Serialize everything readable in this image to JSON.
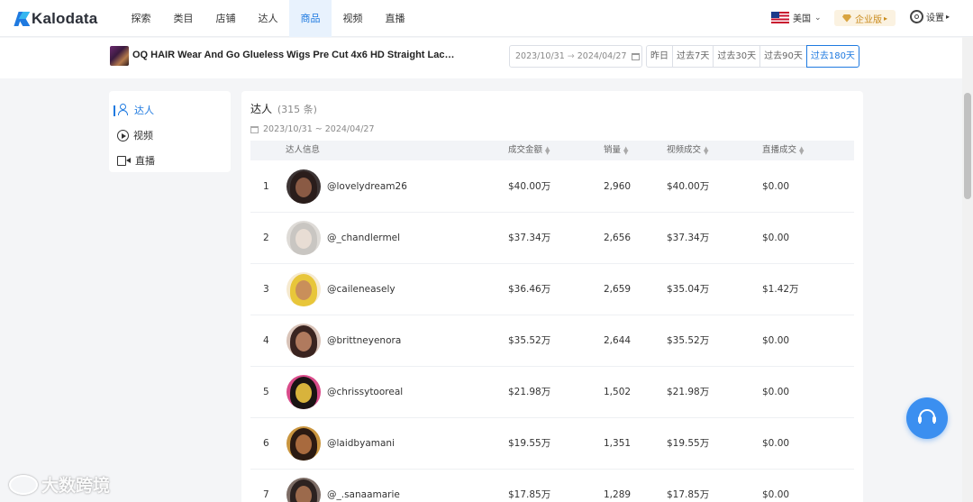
{
  "header": {
    "logo_text": "Kalodata",
    "nav": [
      "探索",
      "类目",
      "店铺",
      "达人",
      "商品",
      "视频",
      "直播"
    ],
    "active_nav_index": 4,
    "region_label": "美国",
    "enterprise_label": "企业版",
    "settings_label": "设置"
  },
  "product": {
    "title": "OQ HAIR Wear And Go Glueless Wigs Pre Cut 4x6 HD Straight Lace ...",
    "date_start": "2023/10/31",
    "date_arrow": "→",
    "date_end": "2024/04/27",
    "periods": [
      "昨日",
      "过去7天",
      "过去30天",
      "过去90天",
      "过去180天"
    ],
    "active_period_index": 4
  },
  "sidebar": {
    "items": [
      {
        "label": "达人",
        "icon": "person-icon",
        "active": true
      },
      {
        "label": "视频",
        "icon": "play-circle-icon",
        "active": false
      },
      {
        "label": "直播",
        "icon": "video-camera-icon",
        "active": false
      }
    ]
  },
  "panel": {
    "title": "达人",
    "count": "(315 条)",
    "date_range": "2023/10/31 ~ 2024/04/27",
    "columns": {
      "info": "达人信息",
      "gmv": "成交金额",
      "sales": "销量",
      "video_gmv": "视频成交",
      "live_gmv": "直播成交"
    },
    "rows": [
      {
        "rank": "1",
        "handle": "@lovelydream26",
        "gmv": "$40.00万",
        "sales": "2,960",
        "video_gmv": "$40.00万",
        "live_gmv": "$0.00",
        "avatar_hair": "#2a1d1b",
        "avatar_skin": "#8a5a44",
        "avatar_bg": "#3d3535"
      },
      {
        "rank": "2",
        "handle": "@_chandlermel",
        "gmv": "$37.34万",
        "sales": "2,656",
        "video_gmv": "$37.34万",
        "live_gmv": "$0.00",
        "avatar_hair": "#c9c6c2",
        "avatar_skin": "#e8ddd4",
        "avatar_bg": "#dedbd7"
      },
      {
        "rank": "3",
        "handle": "@caileneasely",
        "gmv": "$36.46万",
        "sales": "2,659",
        "video_gmv": "$35.04万",
        "live_gmv": "$1.42万",
        "avatar_hair": "#e8c63a",
        "avatar_skin": "#c98f5a",
        "avatar_bg": "#f6ead0"
      },
      {
        "rank": "4",
        "handle": "@brittneyenora",
        "gmv": "$35.52万",
        "sales": "2,644",
        "video_gmv": "$35.52万",
        "live_gmv": "$0.00",
        "avatar_hair": "#3a2420",
        "avatar_skin": "#b07a5e",
        "avatar_bg": "#d9c3b8"
      },
      {
        "rank": "5",
        "handle": "@chrissytooreal",
        "gmv": "$21.98万",
        "sales": "1,502",
        "video_gmv": "$21.98万",
        "live_gmv": "$0.00",
        "avatar_hair": "#1a1414",
        "avatar_skin": "#d8b33c",
        "avatar_bg": "#d94b8a"
      },
      {
        "rank": "6",
        "handle": "@laidbyamani",
        "gmv": "$19.55万",
        "sales": "1,351",
        "video_gmv": "$19.55万",
        "live_gmv": "$0.00",
        "avatar_hair": "#2b1a12",
        "avatar_skin": "#a86a3e",
        "avatar_bg": "#c9953e"
      },
      {
        "rank": "7",
        "handle": "@_.sanaamarie",
        "gmv": "$17.85万",
        "sales": "1,289",
        "video_gmv": "$17.85万",
        "live_gmv": "$0.00",
        "avatar_hair": "#2c2220",
        "avatar_skin": "#9c6a4c",
        "avatar_bg": "#7d6d66"
      }
    ]
  },
  "watermark": "大数跨境",
  "colors": {
    "accent": "#1f7ae0",
    "enterprise_gold": "#c98a1b",
    "support_button": "#3b8ff0"
  }
}
